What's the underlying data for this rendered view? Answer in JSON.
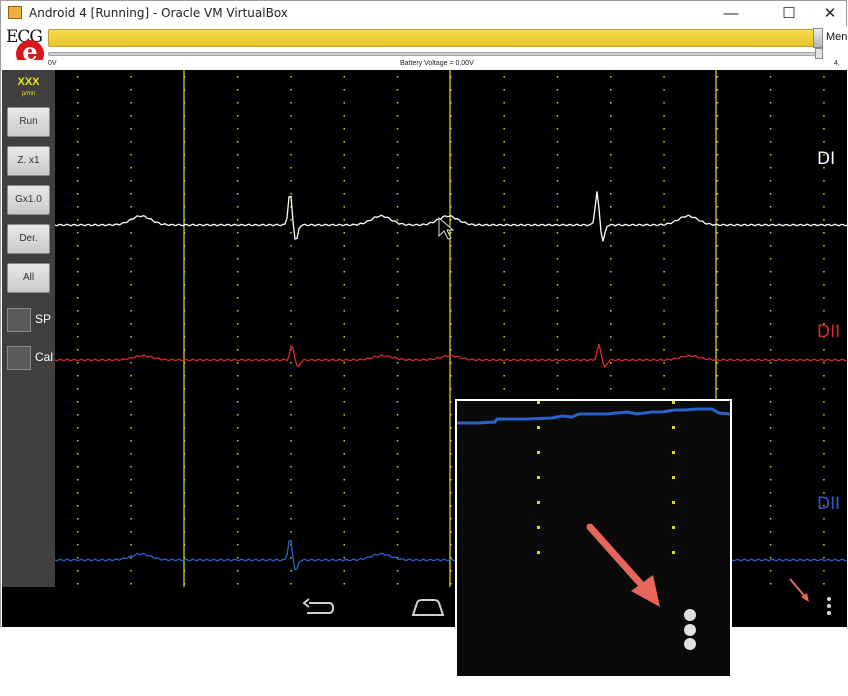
{
  "window": {
    "title": "Android 4 [Running] - Oracle VM VirtualBox",
    "minimize_glyph": "—",
    "maximize_glyph": "☐",
    "close_glyph": "✕"
  },
  "app": {
    "logo": {
      "text": "ECG",
      "letter": "e"
    },
    "menu_label": "Men",
    "status": {
      "left": "0V",
      "center": "Battery Voltage = 0,00V",
      "right": "4,"
    },
    "sidebar": {
      "heart_rate": "XXX",
      "heart_rate_unit": "p/mn",
      "buttons": [
        "Run",
        "Z. x1",
        "Gx1.0",
        "Der.",
        "All"
      ],
      "checkboxes": [
        "SP",
        "Cal"
      ]
    },
    "leads": [
      {
        "label": "DI",
        "color": "#ffffff"
      },
      {
        "label": "DII",
        "color": "#d82a2a"
      },
      {
        "label": "DII",
        "color": "#2a62c8"
      }
    ],
    "colors": {
      "grid_dot": "#d8d820",
      "grid_major": "#e2e02a",
      "accent_arrow": "#e8655a"
    }
  },
  "navbar": {
    "icons": [
      "back-icon",
      "home-icon"
    ]
  },
  "inset": {
    "icons": [
      "overflow-menu-icon"
    ]
  }
}
